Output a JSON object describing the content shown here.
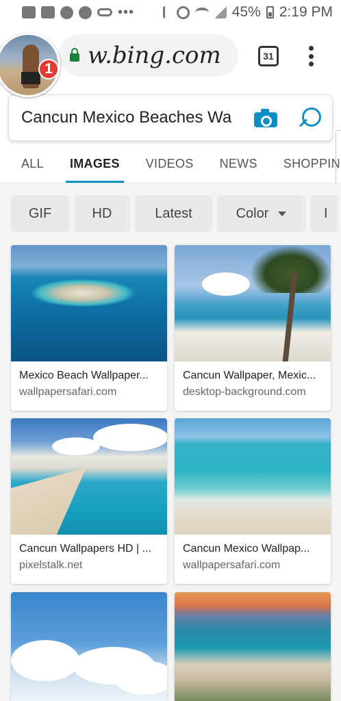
{
  "status_bar": {
    "battery": "45%",
    "time": "2:19 PM"
  },
  "browser": {
    "url": "w.bing.com",
    "tab_count": "31",
    "notification_count": "1"
  },
  "search": {
    "query": "Cancun Mexico Beaches Wa"
  },
  "nav_tabs": [
    {
      "label": "ALL"
    },
    {
      "label": "IMAGES"
    },
    {
      "label": "VIDEOS"
    },
    {
      "label": "NEWS"
    },
    {
      "label": "SHOPPING"
    }
  ],
  "filters": [
    {
      "label": "GIF"
    },
    {
      "label": "HD"
    },
    {
      "label": "Latest"
    },
    {
      "label": "Color"
    },
    {
      "label": "I"
    }
  ],
  "results": [
    {
      "title": "Mexico Beach Wallpaper...",
      "source": "wallpapersafari.com"
    },
    {
      "title": "Cancun Wallpaper, Mexic...",
      "source": "desktop-background.com"
    },
    {
      "title": "Cancun Wallpapers HD | ...",
      "source": "pixelstalk.net"
    },
    {
      "title": "Cancun Mexico Wallpap...",
      "source": "wallpapersafari.com"
    }
  ],
  "colors": {
    "accent": "#0c8ec5",
    "lock": "#188038",
    "badge": "#e53935"
  }
}
